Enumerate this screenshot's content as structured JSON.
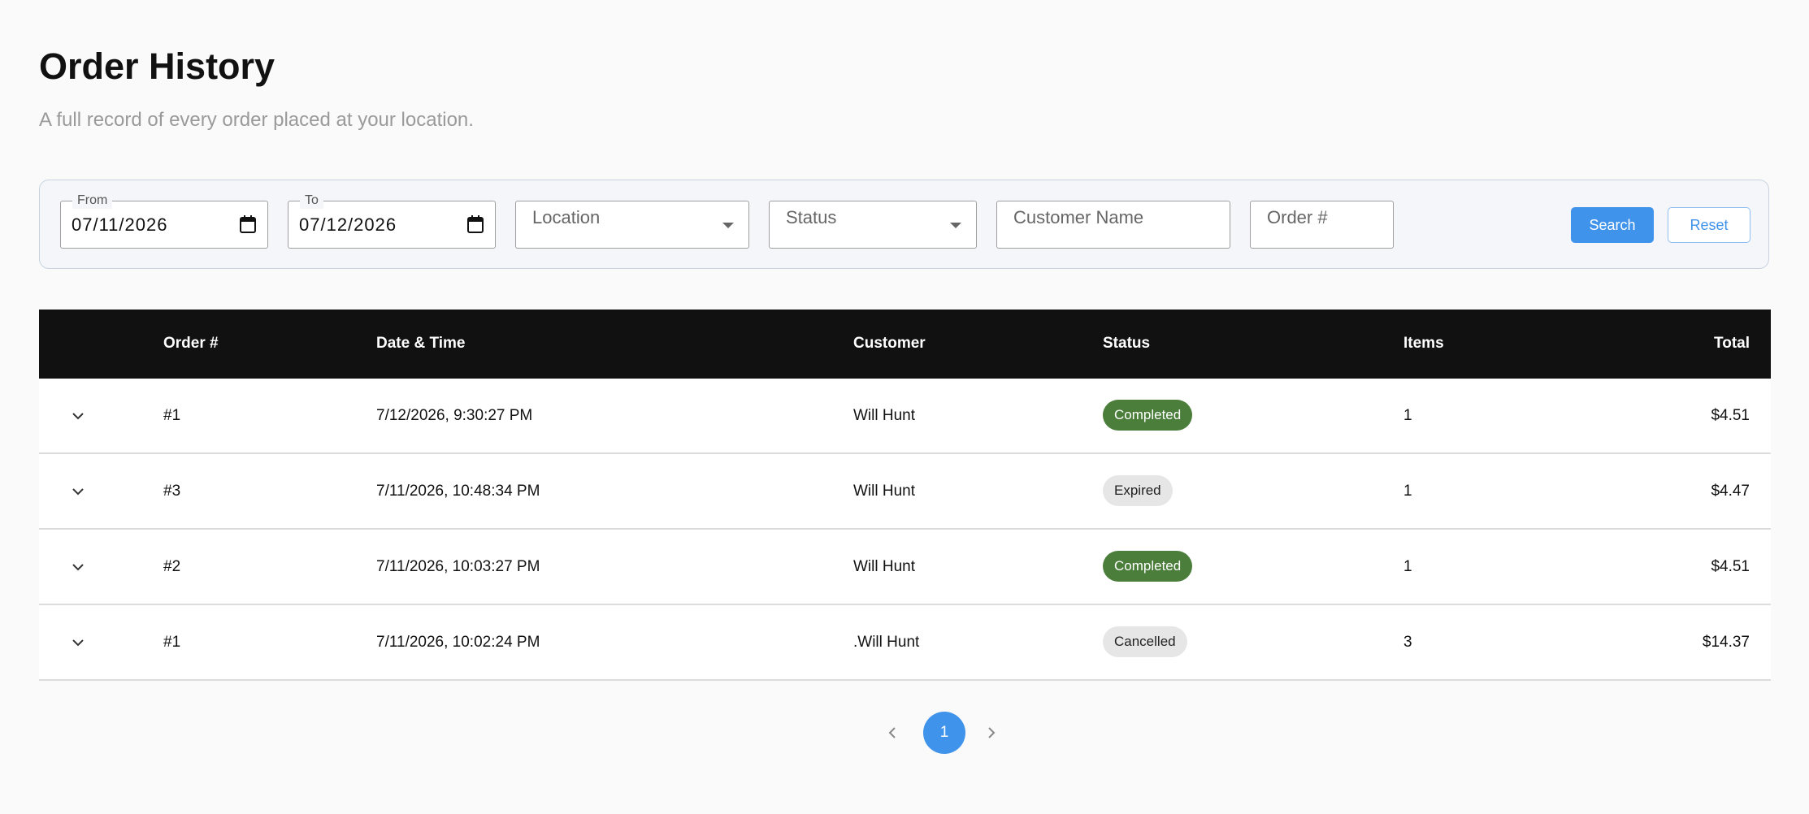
{
  "page": {
    "title": "Order History",
    "subtitle": "A full record of every order placed at your location."
  },
  "filters": {
    "from": {
      "label": "From",
      "value": "07/11/2026"
    },
    "to": {
      "label": "To",
      "value": "07/12/2026"
    },
    "location": {
      "placeholder": "Location"
    },
    "status": {
      "placeholder": "Status"
    },
    "customer_name": {
      "placeholder": "Customer Name"
    },
    "order_number": {
      "placeholder": "Order #"
    },
    "search_label": "Search",
    "reset_label": "Reset"
  },
  "table": {
    "headers": {
      "order": "Order #",
      "date": "Date & Time",
      "customer": "Customer",
      "status": "Status",
      "items": "Items",
      "total": "Total"
    },
    "rows": [
      {
        "order": "#1",
        "date": "7/12/2026, 9:30:27 PM",
        "customer": "Will Hunt",
        "status": "Completed",
        "status_kind": "completed",
        "items": "1",
        "total": "$4.51"
      },
      {
        "order": "#3",
        "date": "7/11/2026, 10:48:34 PM",
        "customer": "Will Hunt",
        "status": "Expired",
        "status_kind": "neutral",
        "items": "1",
        "total": "$4.47"
      },
      {
        "order": "#2",
        "date": "7/11/2026, 10:03:27 PM",
        "customer": "Will Hunt",
        "status": "Completed",
        "status_kind": "completed",
        "items": "1",
        "total": "$4.51"
      },
      {
        "order": "#1",
        "date": "7/11/2026, 10:02:24 PM",
        "customer": ".Will Hunt",
        "status": "Cancelled",
        "status_kind": "neutral",
        "items": "3",
        "total": "$14.37"
      }
    ]
  },
  "pagination": {
    "current_page": "1"
  },
  "colors": {
    "accent": "#3f93ea",
    "completed": "#4a7e3a",
    "header_bg": "#111111"
  }
}
